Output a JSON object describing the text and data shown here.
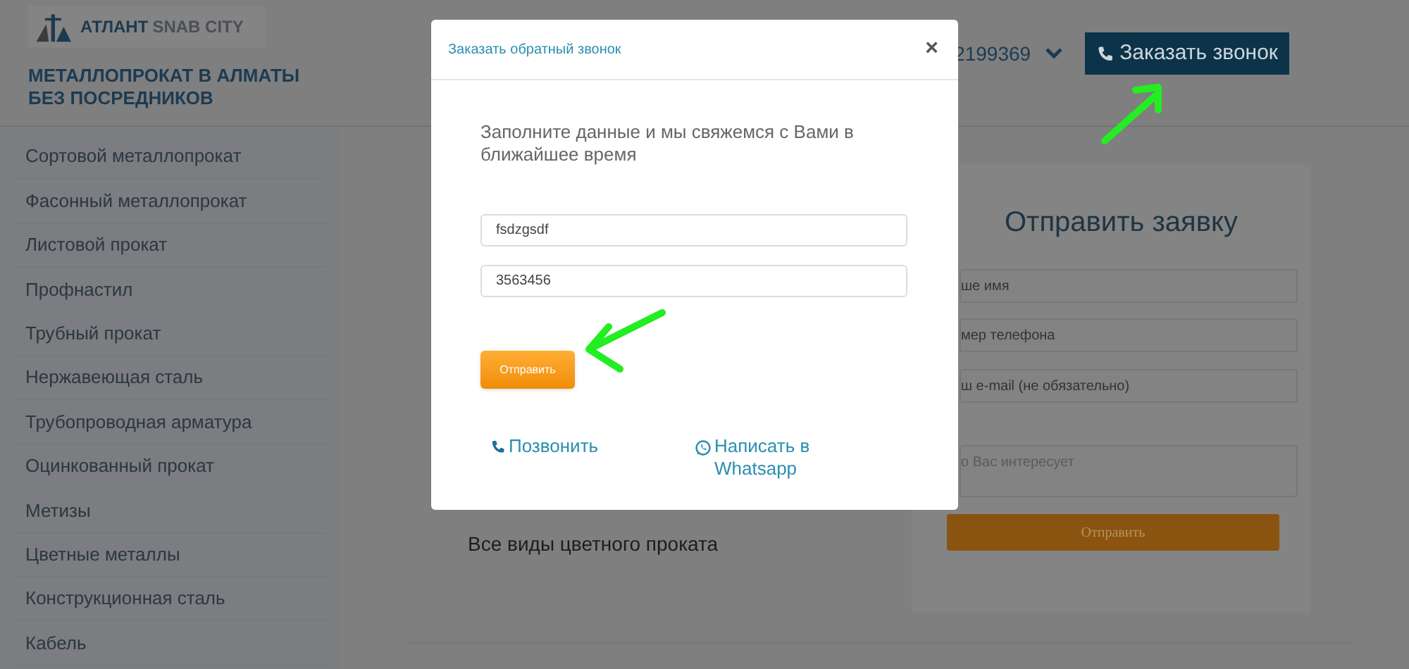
{
  "header": {
    "logo": {
      "brand": "АТЛАНТ",
      "suffix": "SNAB CITY"
    },
    "tagline": [
      "МЕТАЛЛОПРОКАТ В АЛМАТЫ",
      "БЕЗ ПОСРЕДНИКОВ"
    ],
    "phone": "2199369",
    "call_button": "Заказать звонок"
  },
  "sidebar": {
    "items": [
      "Сортовой металлопрокат",
      "Фасонный металлопрокат",
      "Листовой прокат",
      "Профнастил",
      "Трубный прокат",
      "Нержавеющая сталь",
      "Трубопроводная арматура",
      "Оцинкованный прокат",
      "Метизы",
      "Цветные металлы",
      "Конструкционная сталь",
      "Кабель"
    ]
  },
  "content": {
    "text": "Все виды цветного проката"
  },
  "request_form": {
    "title": "Отправить заявку",
    "fields": [
      {
        "kind": "input",
        "placeholder": "ше имя"
      },
      {
        "kind": "input",
        "placeholder": "мер телефона"
      },
      {
        "kind": "input",
        "placeholder": "ш e-mail (не обязательно)"
      },
      {
        "kind": "textarea",
        "placeholder": "о Вас интересует"
      }
    ],
    "submit": "Отправить"
  },
  "modal": {
    "title": "Заказать обратный звонок",
    "close": "×",
    "message": "Заполните данные и мы свяжемся с Вами в ближайшее время",
    "fields": [
      {
        "value": "fsdzgsdf"
      },
      {
        "value": "3563456"
      }
    ],
    "submit": "Отправить",
    "links": [
      {
        "kind": "phone",
        "label": "Позвонить"
      },
      {
        "kind": "whatsapp",
        "label": "Написать в Whatsapp"
      }
    ]
  }
}
